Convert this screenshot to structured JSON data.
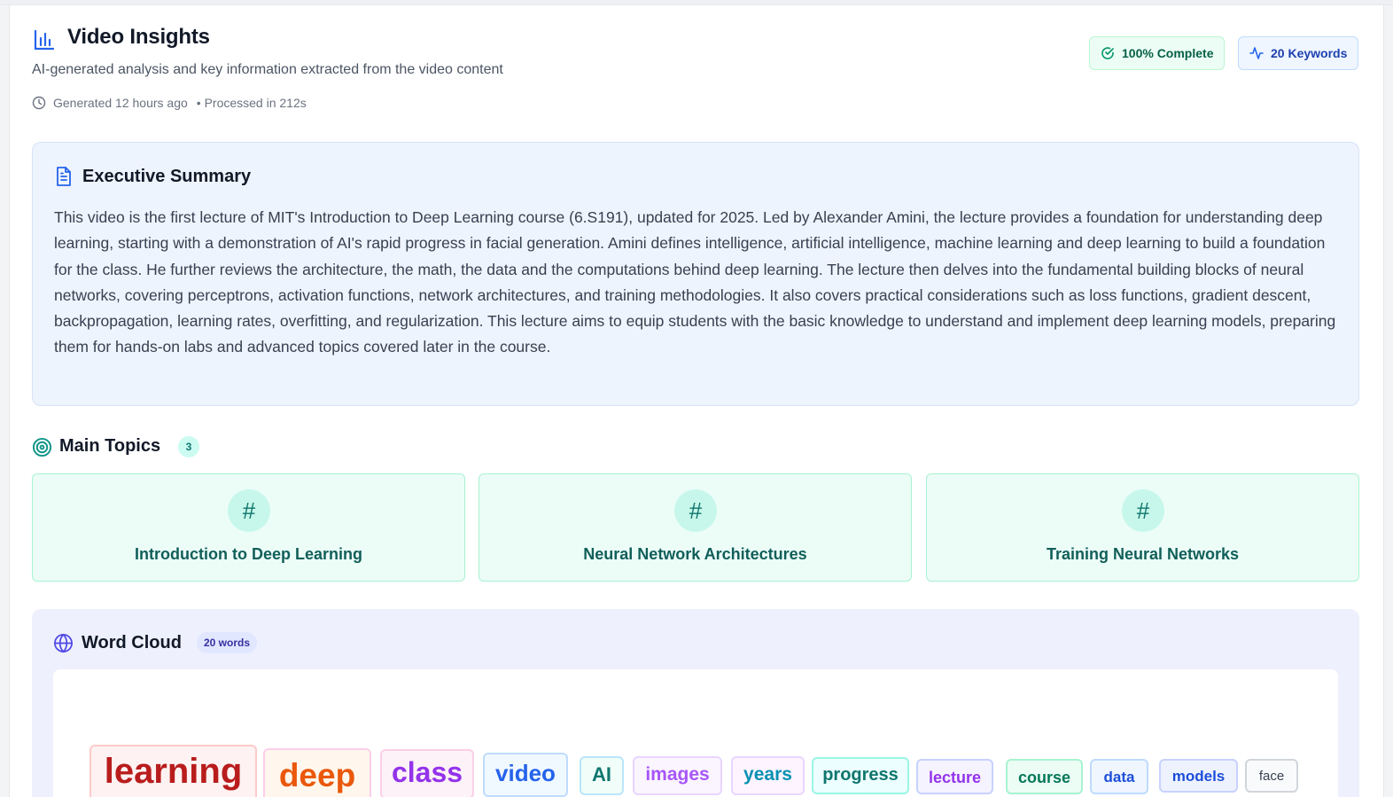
{
  "header": {
    "title": "Video Insights",
    "subtitle": "AI-generated analysis and key information extracted from the video content",
    "generated": "Generated 12 hours ago",
    "processed": "• Processed in 212s",
    "badges": {
      "complete": "100% Complete",
      "keywords": "20 Keywords"
    }
  },
  "summary": {
    "title": "Executive Summary",
    "text": "This video is the first lecture of MIT's Introduction to Deep Learning course (6.S191), updated for 2025. Led by Alexander Amini, the lecture provides a foundation for understanding deep learning, starting with a demonstration of AI's rapid progress in facial generation. Amini defines intelligence, artificial intelligence, machine learning and deep learning to build a foundation for the class. He further reviews the architecture, the math, the data and the computations behind deep learning. The lecture then delves into the fundamental building blocks of neural networks, covering perceptrons, activation functions, network architectures, and training methodologies. It also covers practical considerations such as loss functions, gradient descent, backpropagation, learning rates, overfitting, and regularization. This lecture aims to equip students with the basic knowledge to understand and implement deep learning models, preparing them for hands-on labs and advanced topics covered later in the course."
  },
  "topics": {
    "title": "Main Topics",
    "count": "3",
    "hash_symbol": "#",
    "items": [
      {
        "label": "Introduction to Deep Learning"
      },
      {
        "label": "Neural Network Architectures"
      },
      {
        "label": "Training Neural Networks"
      }
    ]
  },
  "word_cloud": {
    "title": "Word Cloud",
    "count_label": "20 words",
    "words": [
      {
        "text": "learning",
        "color": "#b91c1c",
        "bg": "#fef2f2",
        "border": "#fecaca"
      },
      {
        "text": "deep",
        "color": "#ea580c",
        "bg": "#fff7ed",
        "border": "#fbcfe8"
      },
      {
        "text": "class",
        "color": "#9333ea",
        "bg": "#fdf2f8",
        "border": "#fbcfe8"
      },
      {
        "text": "video",
        "color": "#2563eb",
        "bg": "#f0f9ff",
        "border": "#bfdbfe"
      },
      {
        "text": "AI",
        "color": "#0f766e",
        "bg": "#f0fdf9",
        "border": "#bae6fd"
      },
      {
        "text": "images",
        "color": "#a855f7",
        "bg": "#faf5ff",
        "border": "#e9d5ff"
      },
      {
        "text": "years",
        "color": "#0891b2",
        "bg": "#fdf4ff",
        "border": "#e9d5ff"
      },
      {
        "text": "progress",
        "color": "#0f766e",
        "bg": "#ecfeff",
        "border": "#99f6e4"
      },
      {
        "text": "lecture",
        "color": "#9333ea",
        "bg": "#f5f3ff",
        "border": "#c7d2fe"
      },
      {
        "text": "course",
        "color": "#047857",
        "bg": "#ecfdf5",
        "border": "#a7f3d0"
      },
      {
        "text": "data",
        "color": "#1d4ed8",
        "bg": "#eff6ff",
        "border": "#bfdbfe"
      },
      {
        "text": "models",
        "color": "#1d4ed8",
        "bg": "#eef2ff",
        "border": "#c7d2fe"
      },
      {
        "text": "face",
        "color": "#374151",
        "bg": "#f9fafb",
        "border": "#d1d5db"
      }
    ]
  },
  "colors": {
    "accent_blue": "#2563eb",
    "accent_teal": "#0d9488",
    "accent_indigo": "#4f46e5"
  },
  "icons": {
    "header": "bar-chart-icon",
    "clock": "clock-icon",
    "complete": "check-circle-icon",
    "keywords": "activity-icon",
    "summary": "document-icon",
    "topics": "target-icon",
    "cloud": "globe-icon"
  }
}
